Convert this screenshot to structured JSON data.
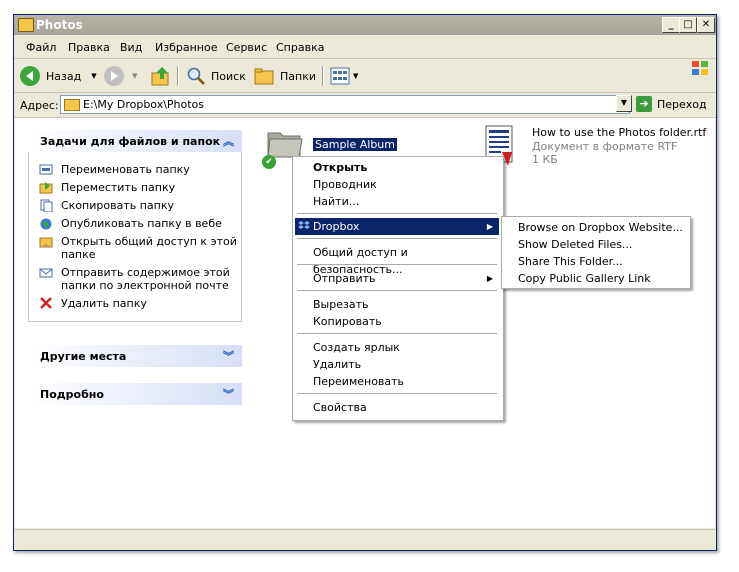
{
  "window": {
    "title": "Photos"
  },
  "menubar": [
    "Файл",
    "Правка",
    "Вид",
    "Избранное",
    "Сервис",
    "Справка"
  ],
  "toolbar": {
    "back": "Назад",
    "search": "Поиск",
    "folders": "Папки"
  },
  "address": {
    "label": "Адрес:",
    "value": "E:\\My Dropbox\\Photos",
    "go": "Переход"
  },
  "taskpane": {
    "file_tasks": {
      "title": "Задачи для файлов и папок",
      "items": [
        "Переименовать папку",
        "Переместить папку",
        "Скопировать папку",
        "Опубликовать папку в вебе",
        "Открыть общий доступ к этой папке",
        "Отправить содержимое этой папки по электронной почте",
        "Удалить папку"
      ]
    },
    "other_places": "Другие места",
    "details": "Подробно"
  },
  "files": {
    "folder": {
      "name": "Sample Album"
    },
    "rtf": {
      "name": "How to use the Photos folder.rtf",
      "type": "Документ в формате RTF",
      "size": "1 КБ"
    }
  },
  "context_menu": {
    "open": "Открыть",
    "explorer": "Проводник",
    "find": "Найти...",
    "dropbox": "Dropbox",
    "sharing": "Общий доступ и безопасность...",
    "send_to": "Отправить",
    "cut": "Вырезать",
    "copy": "Копировать",
    "shortcut": "Создать ярлык",
    "delete": "Удалить",
    "rename": "Переименовать",
    "properties": "Свойства"
  },
  "dropbox_submenu": [
    "Browse on Dropbox Website...",
    "Show Deleted Files...",
    "Share This Folder...",
    "Copy Public Gallery Link"
  ],
  "colors": {
    "selection": "#0a246a",
    "pane_header": "#d6dff7",
    "chrome": "#ece9d8"
  }
}
